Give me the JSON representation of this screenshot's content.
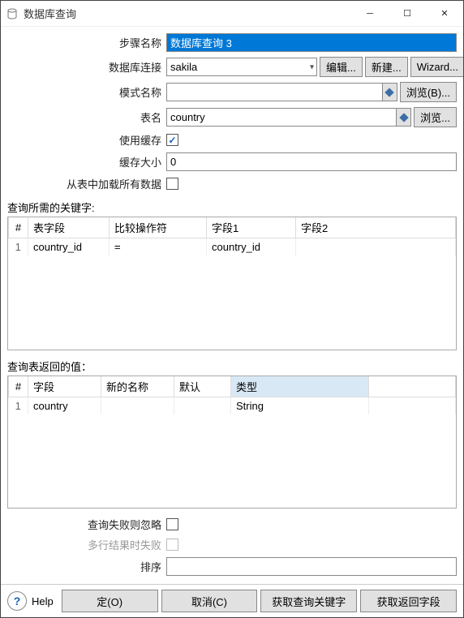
{
  "window": {
    "title": "数据库查询"
  },
  "form": {
    "stepName": {
      "label": "步骤名称",
      "value": "数据库查询 3"
    },
    "connection": {
      "label": "数据库连接",
      "value": "sakila",
      "edit_btn": "编辑...",
      "new_btn": "新建...",
      "wizard_btn": "Wizard..."
    },
    "schema": {
      "label": "模式名称",
      "value": "",
      "browse_btn": "浏览(B)..."
    },
    "table": {
      "label": "表名",
      "value": "country",
      "browse_btn": "浏览..."
    },
    "useCache": {
      "label": "使用缓存",
      "checked": true
    },
    "cacheSize": {
      "label": "缓存大小",
      "value": "0"
    },
    "loadAll": {
      "label": "从表中加载所有数据",
      "checked": false
    },
    "ignoreFail": {
      "label": "查询失败则忽略",
      "checked": false
    },
    "multiRowFail": {
      "label": "多行结果时失败",
      "checked": false
    },
    "sort": {
      "label": "排序",
      "value": ""
    }
  },
  "keysSection": {
    "title": "查询所需的关键字:",
    "headers": {
      "num": "#",
      "field": "表字段",
      "op": "比较操作符",
      "f1": "字段1",
      "f2": "字段2"
    },
    "rows": [
      {
        "num": "1",
        "field": "country_id",
        "op": "=",
        "f1": "country_id",
        "f2": ""
      }
    ]
  },
  "returnSection": {
    "title": "查询表返回的值：",
    "headers": {
      "num": "#",
      "field": "字段",
      "newname": "新的名称",
      "default": "默认",
      "type": "类型"
    },
    "rows": [
      {
        "num": "1",
        "field": "country",
        "newname": "",
        "default": "",
        "type": "String"
      }
    ]
  },
  "footer": {
    "help": "Help",
    "ok": "定(O)",
    "cancel": "取消(C)",
    "getKeys": "获取查询关键字",
    "getReturn": "获取返回字段"
  }
}
